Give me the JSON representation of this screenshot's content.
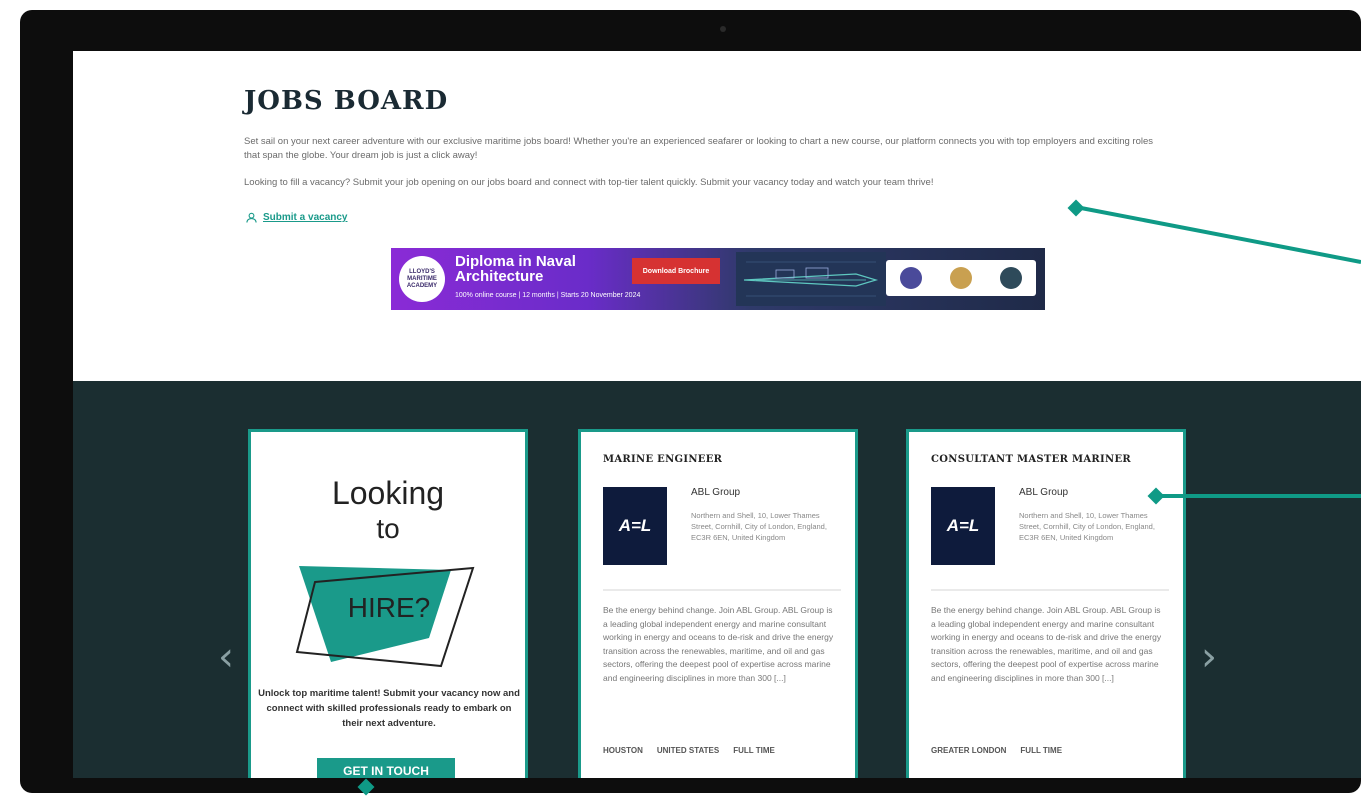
{
  "page": {
    "title": "JOBS BOARD",
    "intro": "Set sail on your next career adventure with our exclusive maritime jobs board! Whether you're an experienced seafarer or looking to chart a new course, our platform connects you with top employers and exciting roles that span the globe. Your dream job is just a click away!",
    "intro2": "Looking to fill a vacancy? Submit your job opening on our jobs board and connect with top-tier talent quickly. Submit your vacancy today and watch your team thrive!",
    "submit_link": "Submit a vacancy"
  },
  "banner": {
    "logo_text": "LLOYD'S MARITIME ACADEMY",
    "title": "Diploma in Naval Architecture",
    "subtitle": "100% online course | 12 months | Starts 20 November 2024",
    "button": "Download Brochure",
    "colors": {
      "purple": "#8a2bd6",
      "red": "#d63232"
    }
  },
  "hire_card": {
    "line1": "Looking",
    "line2": "to",
    "big_word": "HIRE?",
    "description": "Unlock top maritime talent! Submit your vacancy now and connect with skilled professionals ready to embark on their next adventure.",
    "button": "GET IN TOUCH"
  },
  "jobs": [
    {
      "title": "MARINE ENGINEER",
      "company": "ABL Group",
      "logo": "A=L",
      "address": "Northern and Shell, 10, Lower Thames Street, Cornhill, City of London, England, EC3R 6EN, United Kingdom",
      "description": "Be the energy behind change. Join ABL Group. ABL Group is a leading global independent energy and marine consultant working in energy and oceans to de-risk and drive the energy transition across the renewables, maritime, and oil and gas sectors, offering the deepest pool of expertise across marine and engineering disciplines in more than 300 [...]",
      "tags": [
        "HOUSTON",
        "UNITED STATES",
        "FULL TIME"
      ]
    },
    {
      "title": "CONSULTANT MASTER MARINER",
      "company": "ABL Group",
      "logo": "A=L",
      "address": "Northern and Shell, 10, Lower Thames Street, Cornhill, City of London, England, EC3R 6EN, United Kingdom",
      "description": "Be the energy behind change. Join ABL Group. ABL Group is a leading global independent energy and marine consultant working in energy and oceans to de-risk and drive the energy transition across the renewables, maritime, and oil and gas sectors, offering the deepest pool of expertise across marine and engineering disciplines in more than 300 [...]",
      "tags": [
        "GREATER LONDON",
        "FULL TIME"
      ]
    }
  ],
  "carousel": {
    "prev_icon": "chevron-left-icon",
    "next_icon": "chevron-right-icon"
  },
  "colors": {
    "teal": "#1a9a8a",
    "dark_bg": "#1b2e31",
    "callout": "#0f9a86"
  }
}
